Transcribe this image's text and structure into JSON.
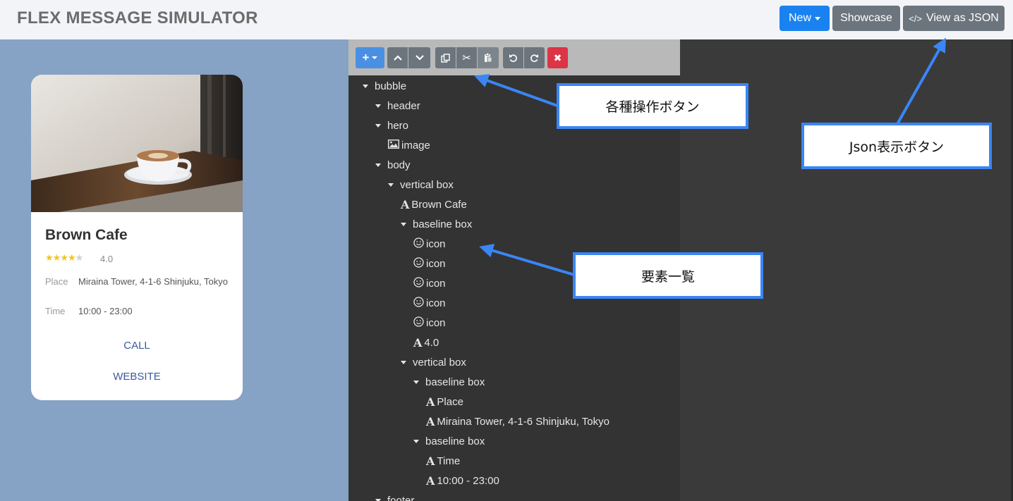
{
  "app": {
    "title": "FLEX MESSAGE SIMULATOR"
  },
  "header_buttons": {
    "new": "New",
    "showcase": "Showcase",
    "view_json": "View as JSON",
    "code_glyph": "</>"
  },
  "card": {
    "title": "Brown Cafe",
    "rating_stars": 4,
    "rating_max": 5,
    "rating_text": "4.0",
    "place_label": "Place",
    "place_value": "Miraina Tower, 4-1-6 Shinjuku, Tokyo",
    "time_label": "Time",
    "time_value": "10:00 - 23:00",
    "call_label": "CALL",
    "website_label": "WEBSITE"
  },
  "toolbar_icons": [
    "add-dropdown-icon",
    "move-up-icon",
    "move-down-icon",
    "copy-icon",
    "cut-icon",
    "paste-icon",
    "undo-icon",
    "redo-icon",
    "delete-icon"
  ],
  "tree": [
    {
      "label": "bubble",
      "kind": "container"
    },
    {
      "label": "header",
      "kind": "container"
    },
    {
      "label": "hero",
      "kind": "container"
    },
    {
      "label": "image",
      "kind": "image"
    },
    {
      "label": "body",
      "kind": "container"
    },
    {
      "label": "vertical box",
      "kind": "container"
    },
    {
      "label": "Brown Cafe",
      "kind": "text"
    },
    {
      "label": "baseline box",
      "kind": "container"
    },
    {
      "label": "icon",
      "kind": "icon"
    },
    {
      "label": "icon",
      "kind": "icon"
    },
    {
      "label": "icon",
      "kind": "icon"
    },
    {
      "label": "icon",
      "kind": "icon"
    },
    {
      "label": "icon",
      "kind": "icon"
    },
    {
      "label": "4.0",
      "kind": "text"
    },
    {
      "label": "vertical box",
      "kind": "container"
    },
    {
      "label": "baseline box",
      "kind": "container"
    },
    {
      "label": "Place",
      "kind": "text"
    },
    {
      "label": "Miraina Tower, 4-1-6 Shinjuku, Tokyo",
      "kind": "text"
    },
    {
      "label": "baseline box",
      "kind": "container"
    },
    {
      "label": "Time",
      "kind": "text"
    },
    {
      "label": "10:00 - 23:00",
      "kind": "text"
    },
    {
      "label": "footer",
      "kind": "container"
    }
  ],
  "annotations": {
    "toolbar_note": "各種操作ボタン",
    "tree_note": "要素一覧",
    "json_note": "Json表示ボタン"
  },
  "colors": {
    "accent": "#1a82f0",
    "secondary": "#6c757d",
    "danger": "#dc3545",
    "preview_bg": "#86a2c4",
    "callout_border": "#3a86f5"
  }
}
